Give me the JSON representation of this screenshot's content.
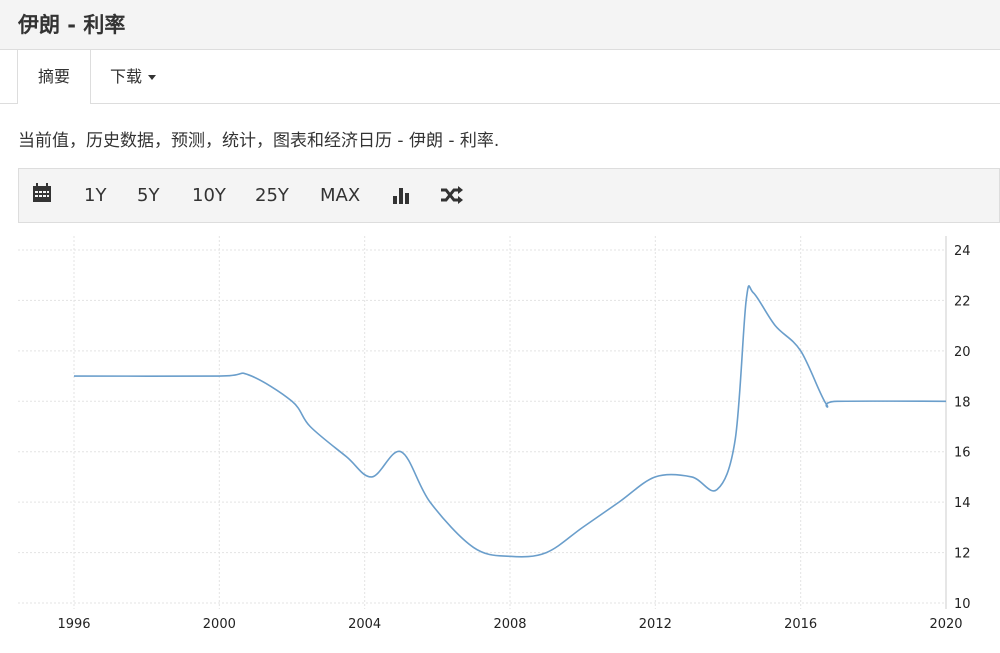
{
  "header": {
    "title": "伊朗 - 利率"
  },
  "tabs": {
    "summary": "摘要",
    "download": "下载"
  },
  "description": "当前值，历史数据，预测，统计，图表和经济日历 - 伊朗 - 利率.",
  "toolbar": {
    "calendar_icon": "calendar-icon",
    "ranges": [
      "1Y",
      "5Y",
      "10Y",
      "25Y",
      "MAX"
    ],
    "bar_icon": "bar-chart-icon",
    "shuffle_icon": "shuffle-icon"
  },
  "chart_data": {
    "type": "line",
    "title": "伊朗 - 利率",
    "xlabel": "",
    "ylabel": "",
    "xlim": [
      1996,
      2020
    ],
    "ylim": [
      10,
      24
    ],
    "x_ticks": [
      "1996",
      "2000",
      "2004",
      "2008",
      "2012",
      "2016",
      "2020"
    ],
    "y_ticks": [
      "10",
      "12",
      "14",
      "16",
      "18",
      "20",
      "22",
      "24"
    ],
    "grid": true,
    "line_color": "#6a9ecb",
    "series": [
      {
        "name": "利率",
        "x": [
          1996,
          2000,
          2000.8,
          2002,
          2002.5,
          2003.5,
          2004.2,
          2005,
          2005.8,
          2007,
          2008,
          2009,
          2010,
          2011,
          2012,
          2013,
          2013.7,
          2014.2,
          2014.5,
          2014.7,
          2015.3,
          2016,
          2016.7,
          2017,
          2020
        ],
        "y": [
          19,
          19,
          19.05,
          18,
          17,
          15.8,
          15,
          16,
          14,
          12.2,
          11.85,
          12,
          13,
          14,
          15,
          15,
          14.5,
          16.5,
          22,
          22.3,
          21,
          20,
          17.9,
          18,
          18
        ]
      }
    ]
  }
}
